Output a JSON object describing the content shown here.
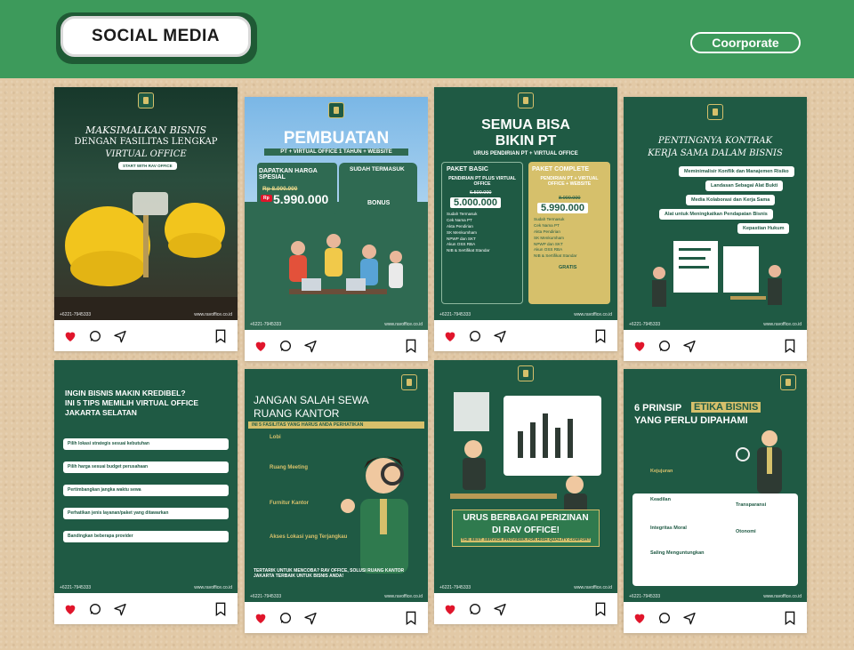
{
  "header": {
    "title": "SOCIAL MEDIA",
    "tag": "Coorporate"
  },
  "colors": {
    "banner": "#3d9a5b",
    "dark_green": "#1f5a44",
    "gold": "#d6c06b",
    "heart": "#e0152b"
  },
  "icons": [
    "heart-icon",
    "comment-icon",
    "share-icon",
    "bookmark-icon"
  ],
  "footer": {
    "contact": "+6221-7945333",
    "site": "www.ravoffice.co.id"
  },
  "posts": [
    {
      "title1": "MAKSIMALKAN BISNIS",
      "title2": "DENGAN FASILITAS LENGKAP",
      "title3": "VIRTUAL OFFICE",
      "cta": "START WITH RAV OFFICE"
    },
    {
      "title1": "PEMBUATAN",
      "subtitle": "PT + VIRTUAL OFFICE 1 TAHUN + WEBSITE",
      "promo": "DAPATKAN HARGA SPESIAL",
      "old_price": "Rp 8.000.000",
      "price_prefix": "Rp",
      "price": "5.990.000",
      "included_title": "SUDAH TERMASUK",
      "bonus_title": "BONUS"
    },
    {
      "title1": "SEMUA BISA",
      "title2": "BIKIN PT",
      "subtitle": "URUS PENDIRIAN PT + VIRTUAL OFFICE",
      "basic": {
        "name": "PAKET BASIC",
        "desc": "PENDIRIAN PT PLUS VIRTUAL OFFICE",
        "old": "6.500.000",
        "price": "5.000.000"
      },
      "complete": {
        "name": "PAKET COMPLETE",
        "desc": "PENDIRIAN PT + VIRTUAL OFFICE + WEBSITE",
        "old": "8.000.000",
        "price": "5.990.000"
      },
      "basic_items": [
        "Sudah Termasuk",
        "Cek Nama PT",
        "Akta Pendirian",
        "SK Menkumham",
        "NPWP dan SKT",
        "Akun OSS RBA",
        "NIB & Sertifikat Standar"
      ],
      "complete_items": [
        "Sudah Termasuk",
        "Cek Nama PT",
        "Akta Pendirian",
        "SK Menkumham",
        "NPWP dan SKT",
        "Akun OSS RBA",
        "NIB & Sertifikat Standar"
      ],
      "gratis": "GRATIS"
    },
    {
      "title1": "PENTINGNYA KONTRAK",
      "title2": "KERJA SAMA DALAM BISNIS",
      "items": [
        "Meminimalisir Konflik dan Manajemen Risiko",
        "Landasan Sebagai Alat Bukti",
        "Media Kolaborasi dan Kerja Sama",
        "Alat untuk Meningkatkan Pendapatan Bisnis",
        "Kepastian Hukum"
      ]
    },
    {
      "title1": "INGIN BISNIS MAKIN KREDIBEL?",
      "title2": "INI 5 TIPS MEMILIH VIRTUAL OFFICE",
      "title3": "JAKARTA SELATAN",
      "tips": [
        "Pilih lokasi strategis sesuai kebutuhan",
        "Pilih harga sesuai budget perusahaan",
        "Pertimbangkan jangka waktu sewa",
        "Perhatikan jenis layanan/paket yang ditawarkan",
        "Bandingkan beberapa provider"
      ]
    },
    {
      "title1": "JANGAN SALAH SEWA",
      "title2": "RUANG KANTOR",
      "subtitle": "INI 5 FASILITAS YANG HARUS ANDA PERHATIKAN",
      "items": [
        "Lobi",
        "Ruang Meeting",
        "Furnitur Kantor",
        "Akses Lokasi yang Terjangkau"
      ],
      "closing": "TERTARIK UNTUK MENCOBA? RAV OFFICE, SOLUSI RUANG KANTOR JAKARTA TERBAIK UNTUK BISNIS ANDA!"
    },
    {
      "title1": "URUS BERBAGAI PERIZINAN",
      "title2": "DI RAV OFFICE!",
      "subtitle": "THE BEST SERVICE PROVIDER FOR HIGH QUALITY COMFORT"
    },
    {
      "title1": "6 PRINSIP",
      "highlight": "ETIKA BISNIS",
      "title2": "YANG PERLU DIPAHAMI",
      "items_left": [
        "Kejujuran",
        "Keadilan",
        "Integritas Moral",
        "Saling Menguntungkan"
      ],
      "items_right": [
        "Transparansi",
        "Otonomi"
      ]
    }
  ]
}
